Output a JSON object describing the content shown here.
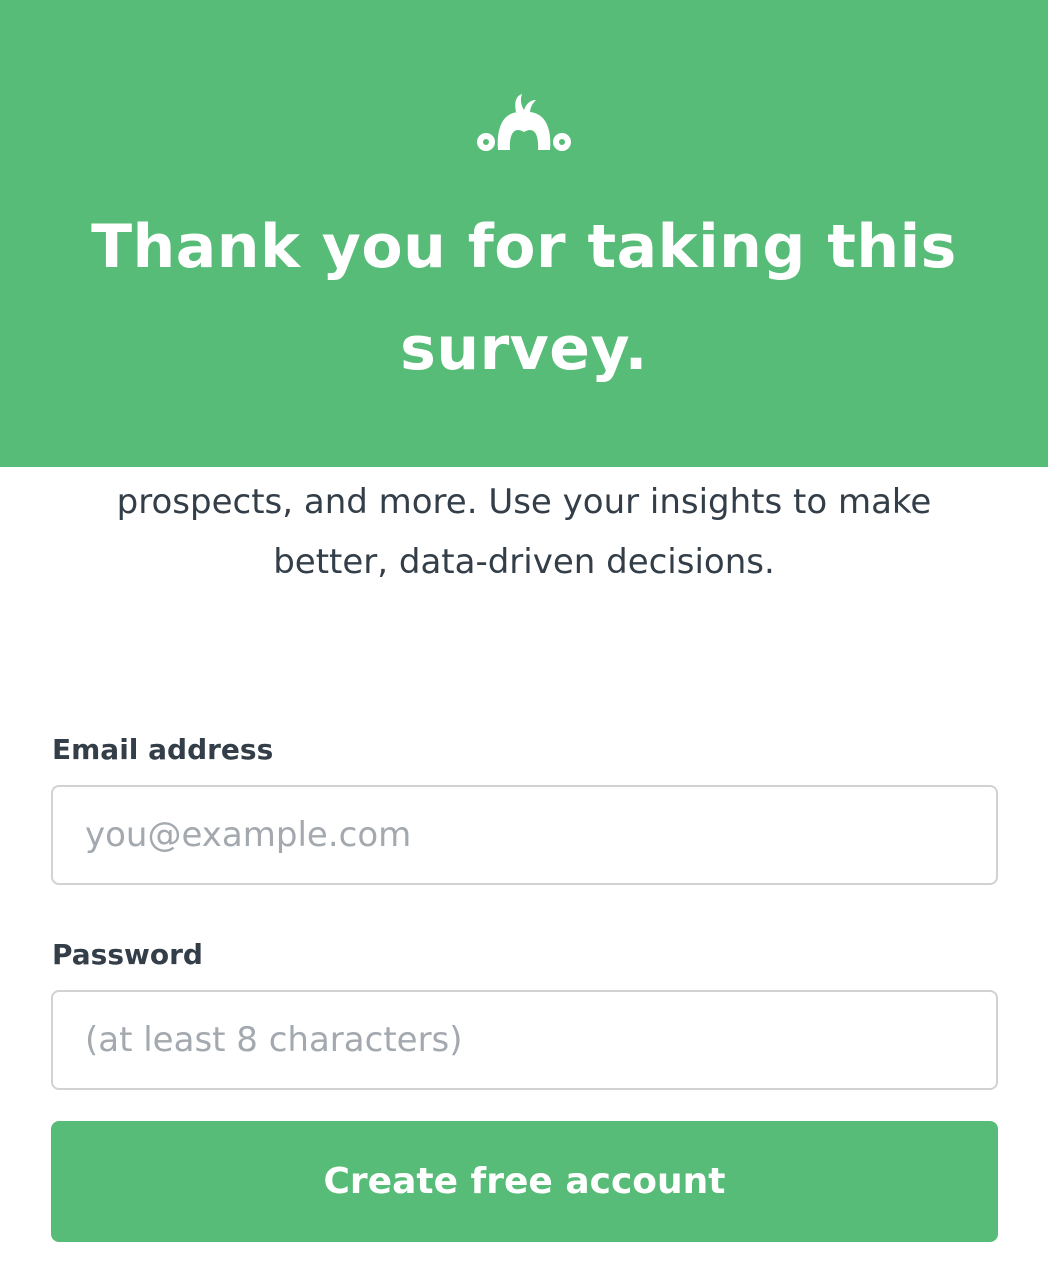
{
  "colors": {
    "brand_green": "#57bc77",
    "text_dark": "#333e48",
    "placeholder_gray": "#a3a9ae",
    "input_border": "#d0d2d3"
  },
  "hero": {
    "logo_icon": "surveymonkey-logo-icon",
    "title": "Thank you for taking this survey."
  },
  "body": {
    "text": "prospects, and more. Use your insights to make better, data-driven decisions."
  },
  "form": {
    "email": {
      "label": "Email address",
      "placeholder": "you@example.com",
      "value": ""
    },
    "password": {
      "label": "Password",
      "placeholder": "(at least 8 characters)",
      "value": ""
    },
    "submit_label": "Create free account"
  }
}
